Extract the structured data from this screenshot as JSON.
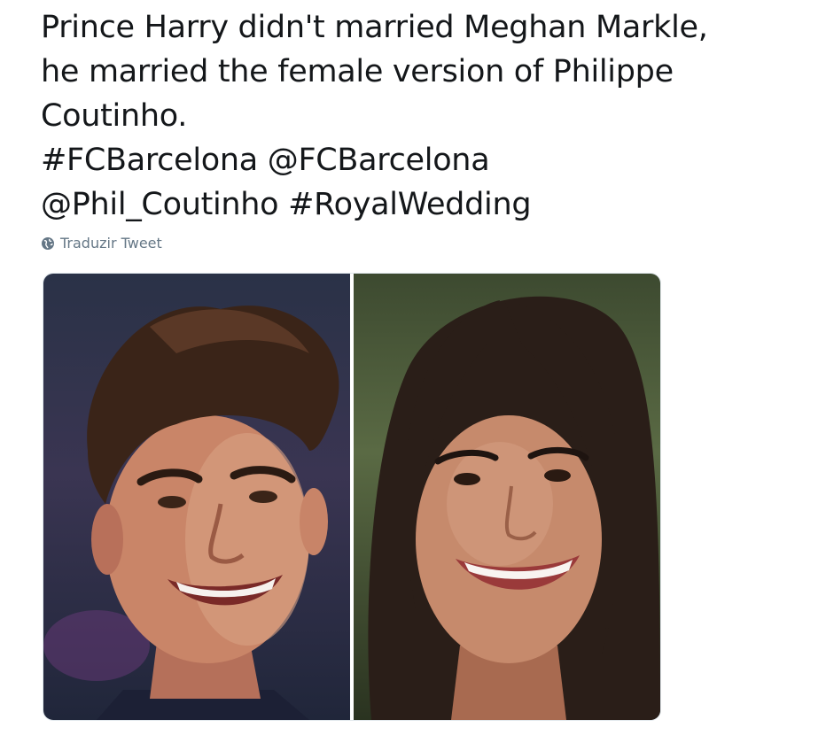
{
  "tweet": {
    "lines": [
      "Prince Harry didn't married Meghan Markle,",
      "he married the female version of Philippe",
      "Coutinho.",
      "#FCBarcelona @FCBarcelona",
      "@Phil_Coutinho  #RoyalWedding"
    ],
    "translate_label": "Traduzir Tweet"
  },
  "media": {
    "photos": [
      {
        "subject": "man-smiling-portrait"
      },
      {
        "subject": "woman-smiling-portrait"
      }
    ]
  },
  "icons": {
    "translate": "globe-icon"
  }
}
